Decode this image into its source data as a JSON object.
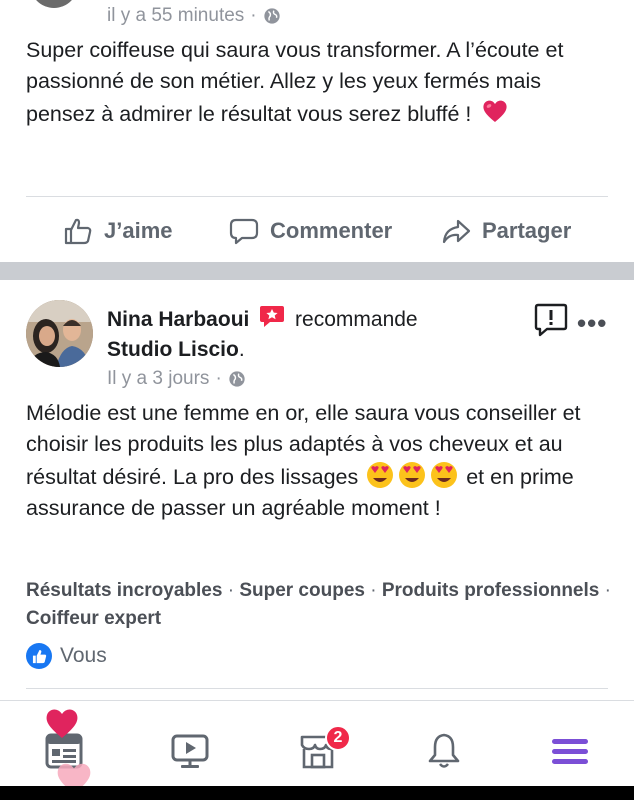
{
  "post1": {
    "timestamp": "il y a 55 minutes",
    "dot": "·",
    "text": "Super coiffeuse qui saura vous transformer. A l’écoute et passionné de son métier. Allez y les yeux fermés mais pensez à admirer le résultat vous serez bluffé !",
    "actions": {
      "like": "J’aime",
      "comment": "Commenter",
      "share": "Partager"
    }
  },
  "post2": {
    "author": "Nina Harbaoui",
    "verb": "recommande",
    "page": "Studio Liscio",
    "period": ".",
    "timestamp": "Il y a 3 jours",
    "dot": "·",
    "text_part1": "Mélodie est une femme en or, elle saura vous conseiller et choisir les produits les plus adaptés à vos cheveux et au résultat désiré. La pro des lissages",
    "text_part2": "et en prime assurance de passer un agréable moment !",
    "tags": [
      "Résultats incroyables",
      "Super coupes",
      "Produits professionnels",
      "Coiffeur expert"
    ],
    "tag_sep": " · ",
    "likes": "Vous"
  },
  "tabbar": {
    "marketplace_badge": "2"
  },
  "colors": {
    "accent": "#1877f2",
    "badge": "#f02849",
    "menu": "#7b4fd6",
    "separator": "#c9ccd1"
  }
}
